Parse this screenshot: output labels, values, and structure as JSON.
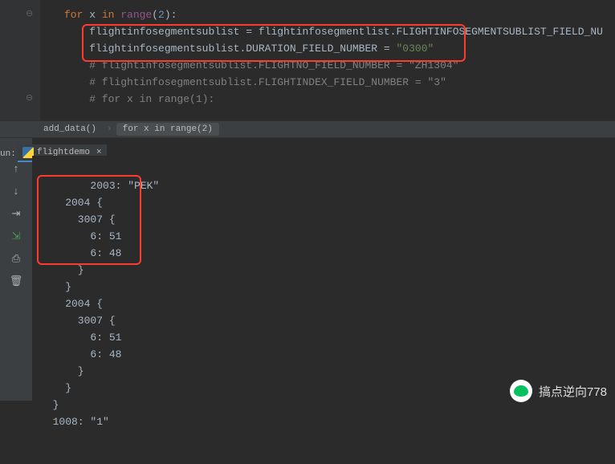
{
  "editor": {
    "lines": {
      "l1_for": "for",
      "l1_x": " x ",
      "l1_in": "in",
      "l1_range": " range",
      "l1_open": "(",
      "l1_num": "2",
      "l1_close": "):",
      "l2_a": "flightinfosegmentsublist = flightinfosegmentlist.",
      "l2_b": "FLIGHTINFOSEGMENTSUBLIST_FIELD_NU",
      "l3_a": "flightinfosegmentsublist.DURATION_FIELD_NUMBER = ",
      "l3_b": "\"0300\"",
      "l4": "# flightinfosegmentsublist.FLIGHTNO_FIELD_NUMBER = \"ZH1304\"",
      "l5": "# flightinfosegmentsublist.FLIGHTINDEX_FIELD_NUMBER = \"3\"",
      "l6": "# for x in range(1):"
    }
  },
  "breadcrumb": {
    "item1": "add_data()",
    "item2": "for x in range(2)"
  },
  "run": {
    "label": "un:",
    "tab": "flightdemo"
  },
  "console_text": "    2003: \"PEK\"\n    2004 {\n      3007 {\n        6: 51\n        6: 48\n      }\n    }\n    2004 {\n      3007 {\n        6: 51\n        6: 48\n      }\n    }\n  }\n  1008: \"1\"",
  "watermark": "搞点逆向778",
  "icons": {
    "rerun": "↑",
    "stop": "↓",
    "wrap": "⇥",
    "scroll": "⇲",
    "print": "⎙",
    "delete": "🗑"
  }
}
